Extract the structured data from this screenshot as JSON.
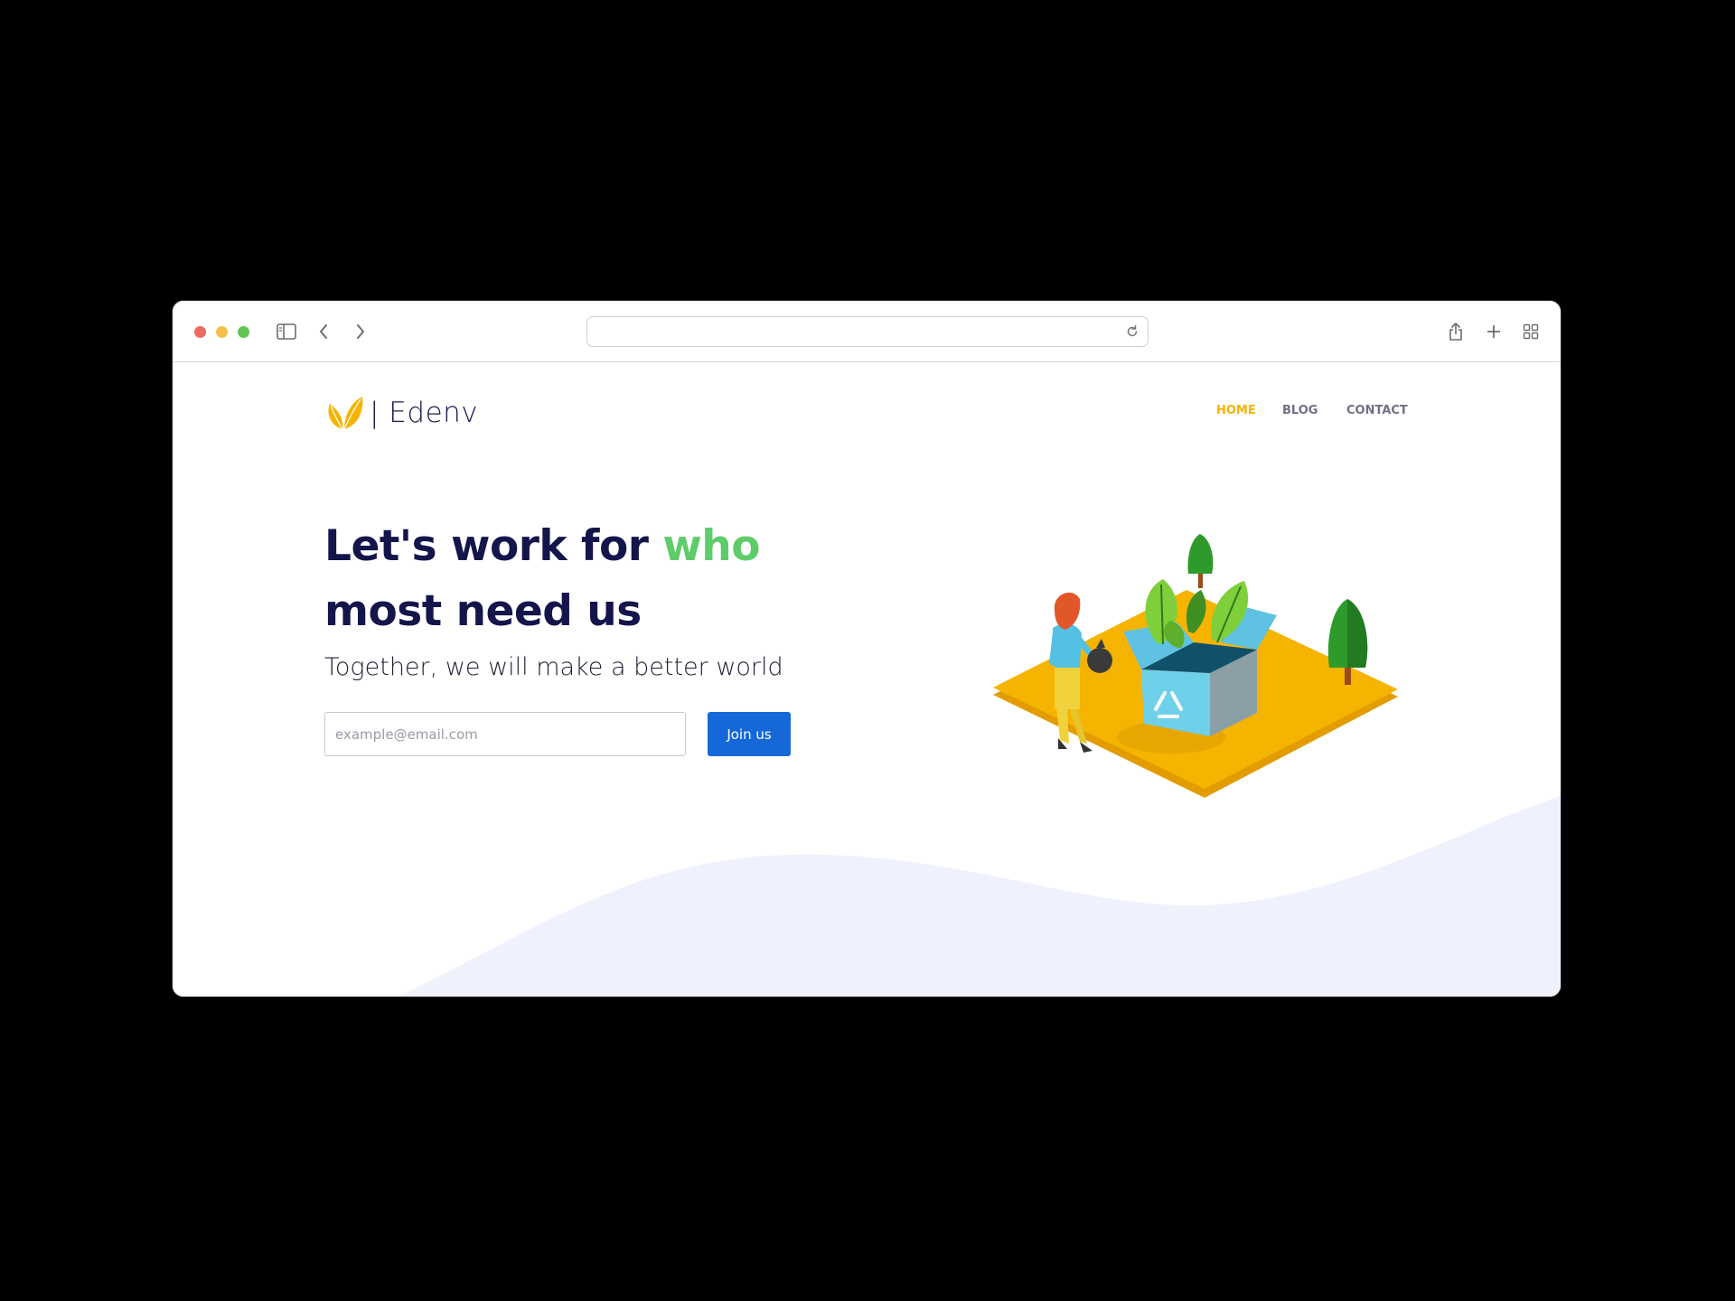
{
  "browser": {
    "address_value": "",
    "icons": [
      "sidebar-icon",
      "back-icon",
      "forward-icon",
      "reload-icon",
      "share-icon",
      "new-tab-icon",
      "tab-overview-icon"
    ]
  },
  "brand": {
    "name": "| Edenv",
    "accent_color": "#f5b400"
  },
  "nav": {
    "items": [
      {
        "label": "HOME",
        "active": true
      },
      {
        "label": "BLOG",
        "active": false
      },
      {
        "label": "CONTACT",
        "active": false
      }
    ]
  },
  "hero": {
    "headline_part1": "Let's work for ",
    "headline_highlight": "who",
    "headline_part2": "most need us",
    "subheadline": "Together, we will make a better world",
    "highlight_color": "#5fcc6a",
    "headline_color": "#14154a"
  },
  "signup": {
    "email_placeholder": "example@email.com",
    "email_value": "",
    "button_label": "Join us",
    "button_color": "#1668d8"
  }
}
